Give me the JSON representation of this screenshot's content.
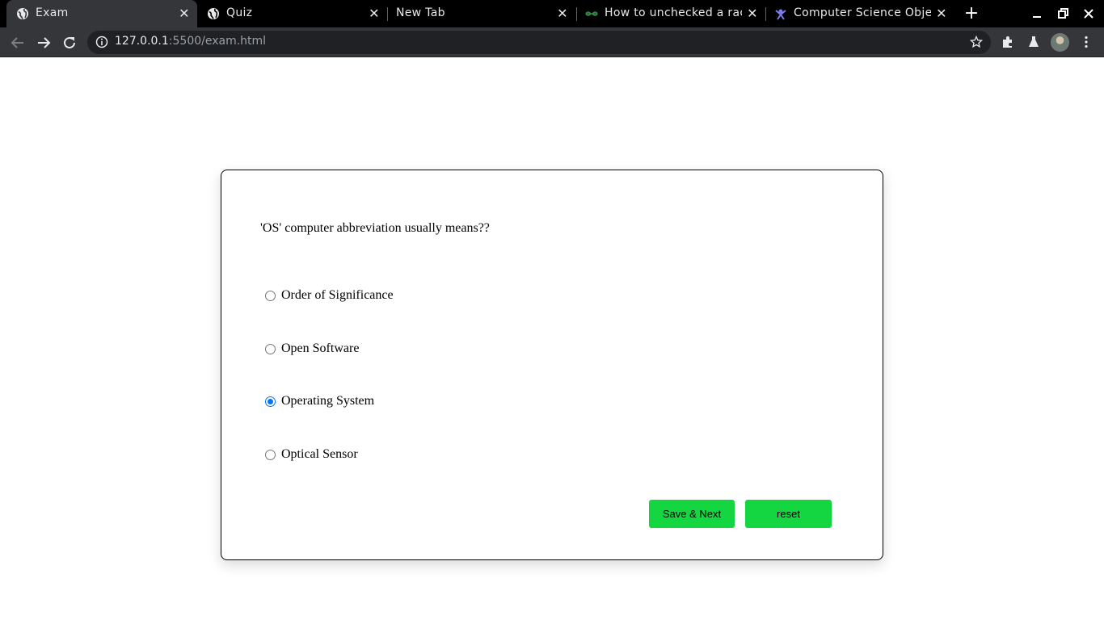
{
  "browser": {
    "tabs": [
      {
        "title": "Exam",
        "icon": "globe-icon",
        "active": true
      },
      {
        "title": "Quiz",
        "icon": "globe-icon",
        "active": false
      },
      {
        "title": "New Tab",
        "icon": "",
        "active": false
      },
      {
        "title": "How to unchecked a rac",
        "icon": "geeksforgeeks-icon",
        "active": false
      },
      {
        "title": "Computer Science Objec",
        "icon": "site-logo-icon",
        "active": false
      }
    ],
    "url_host": "127.0.0.1",
    "url_path": ":5500/exam.html"
  },
  "exam": {
    "question": "'OS' computer abbreviation usually means??",
    "options": [
      {
        "label": "Order of Significance",
        "checked": false
      },
      {
        "label": "Open Software",
        "checked": false
      },
      {
        "label": "Operating System",
        "checked": true
      },
      {
        "label": "Optical Sensor",
        "checked": false
      }
    ],
    "save_next_label": "Save & Next",
    "reset_label": "reset",
    "accent_color": "#14d641",
    "radio_checked_color": "#0075ff"
  }
}
